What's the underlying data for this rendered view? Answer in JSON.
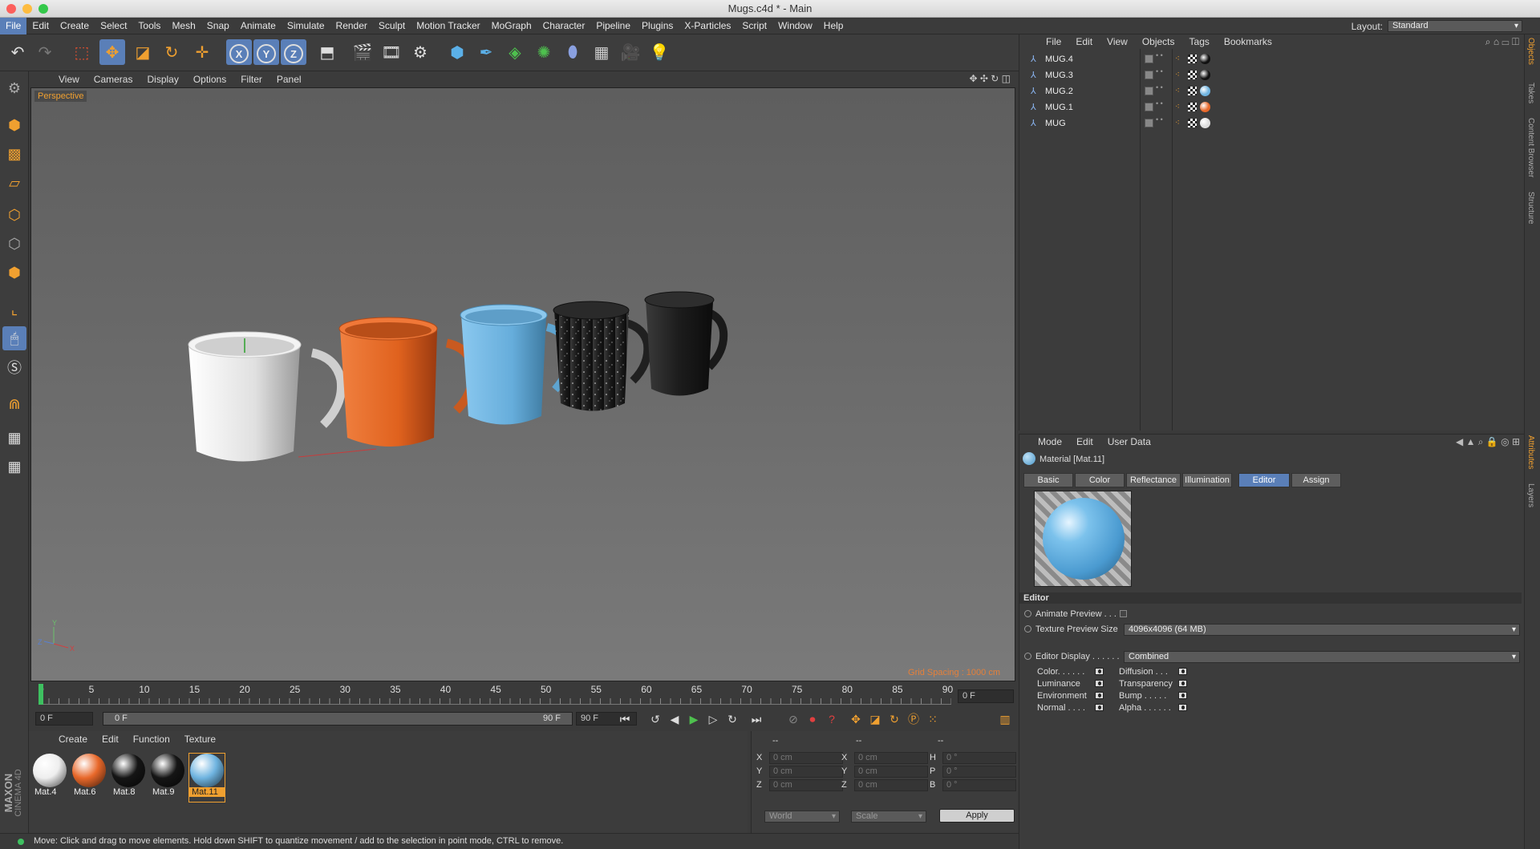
{
  "window": {
    "title": "Mugs.c4d * - Main"
  },
  "menubar": {
    "items": [
      "File",
      "Edit",
      "Create",
      "Select",
      "Tools",
      "Mesh",
      "Snap",
      "Animate",
      "Simulate",
      "Render",
      "Sculpt",
      "Motion Tracker",
      "MoGraph",
      "Character",
      "Pipeline",
      "Plugins",
      "X-Particles",
      "Script",
      "Window",
      "Help"
    ]
  },
  "layout": {
    "label": "Layout:",
    "value": "Standard"
  },
  "viewport": {
    "menu": [
      "View",
      "Cameras",
      "Display",
      "Options",
      "Filter",
      "Panel"
    ],
    "camera_label": "Perspective",
    "grid_spacing": "Grid Spacing : 1000 cm",
    "mugs": [
      {
        "name": "white-mug",
        "color": "#e8e8e8"
      },
      {
        "name": "orange-mug",
        "color": "#e8682a"
      },
      {
        "name": "blue-mug",
        "color": "#6fb4e0"
      },
      {
        "name": "speckled-black-mug",
        "color": "#1c1c1c"
      },
      {
        "name": "black-mug",
        "color": "#262626"
      }
    ]
  },
  "timeline": {
    "ticks": [
      "0",
      "5",
      "10",
      "15",
      "20",
      "25",
      "30",
      "35",
      "40",
      "45",
      "50",
      "55",
      "60",
      "65",
      "70",
      "75",
      "80",
      "85",
      "90"
    ],
    "current_frame": "0 F",
    "start_field": "0 F",
    "range_start": "0 F",
    "range_end": "90 F",
    "end_field": "90 F"
  },
  "material_manager": {
    "menu": [
      "Create",
      "Edit",
      "Function",
      "Texture"
    ],
    "materials": [
      {
        "label": "Mat.4",
        "color": "#eeeeee",
        "selected": false
      },
      {
        "label": "Mat.6",
        "color": "#e8682a",
        "selected": false
      },
      {
        "label": "Mat.8",
        "color": "#151515",
        "selected": false
      },
      {
        "label": "Mat.9",
        "color": "#151515",
        "selected": false
      },
      {
        "label": "Mat.11",
        "color": "#6fb4e0",
        "selected": true
      }
    ]
  },
  "coordinates": {
    "headers": [
      "--",
      "--",
      "--"
    ],
    "rows": [
      {
        "a": "X",
        "av": "0 cm",
        "b": "X",
        "bv": "0 cm",
        "c": "H",
        "cv": "0 °"
      },
      {
        "a": "Y",
        "av": "0 cm",
        "b": "Y",
        "bv": "0 cm",
        "c": "P",
        "cv": "0 °"
      },
      {
        "a": "Z",
        "av": "0 cm",
        "b": "Z",
        "bv": "0 cm",
        "c": "B",
        "cv": "0 °"
      }
    ],
    "mode1": "World",
    "mode2": "Scale",
    "apply_label": "Apply"
  },
  "status": {
    "text": "Move: Click and drag to move elements. Hold down SHIFT to quantize movement / add to the selection in point mode, CTRL to remove."
  },
  "objects": {
    "menu": [
      "File",
      "Edit",
      "View",
      "Objects",
      "Tags",
      "Bookmarks"
    ],
    "rows": [
      {
        "name": "MUG.4",
        "mat_color": "#111111"
      },
      {
        "name": "MUG.3",
        "mat_color": "#111111"
      },
      {
        "name": "MUG.2",
        "mat_color": "#6fb4e0"
      },
      {
        "name": "MUG.1",
        "mat_color": "#e8682a"
      },
      {
        "name": "MUG",
        "mat_color": "#dddddd"
      }
    ]
  },
  "attributes": {
    "menu": [
      "Mode",
      "Edit",
      "User Data"
    ],
    "title": "Material [Mat.11]",
    "tabs": [
      "Basic",
      "Color",
      "Reflectance",
      "Illumination",
      "Editor",
      "Assign"
    ],
    "selected_tab": "Editor",
    "section": "Editor",
    "animate_preview": "Animate Preview . . .",
    "texture_preview_label": "Texture Preview Size",
    "texture_preview_value": "4096x4096 (64 MB)",
    "editor_display_label": "Editor Display . . . . . .",
    "editor_display_value": "Combined",
    "channels_left": [
      "Color. . . . . .",
      "Luminance",
      "Environment",
      "Normal . . . ."
    ],
    "channels_right": [
      "Diffusion . . .",
      "Transparency",
      "Bump . . . . .",
      "Alpha . . . . . ."
    ]
  },
  "right_strip": [
    "Objects",
    "Takes",
    "Content Browser",
    "Structure",
    "Attributes",
    "Layers"
  ],
  "brand": {
    "line1": "MAXON",
    "line2": "CINEMA 4D"
  }
}
